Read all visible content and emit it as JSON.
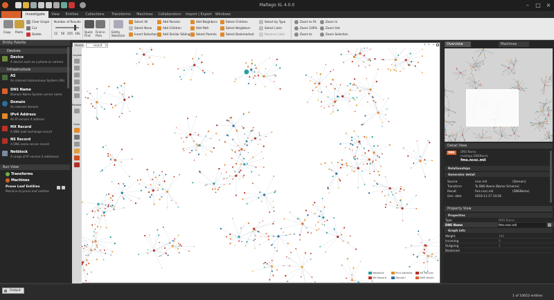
{
  "window": {
    "title": "Maltego XL 4.0.0",
    "quick_access": [
      "new-icon",
      "open-icon",
      "save-icon",
      "undo-icon",
      "redo-icon",
      "print-icon",
      "settings-icon",
      "transform-icon"
    ]
  },
  "menu_tabs": [
    "Investigate",
    "View",
    "Entities",
    "Collections",
    "Transforms",
    "Machines",
    "Collaboration",
    "Import | Export",
    "Windows"
  ],
  "active_tab": "Investigate",
  "ribbon": {
    "copy": "Copy",
    "paste": "Paste",
    "clear_graph": "Clear Graph",
    "cut": "Cut",
    "delete": "Delete",
    "results_label": "Number of Results",
    "results_ticks": [
      "12",
      "50",
      "255",
      "10k"
    ],
    "quick_find": "Quick Find",
    "find_in_files": "Find in Files",
    "entity_selection": "Entity Selection",
    "select_all": "Select All",
    "select_none": "Select None",
    "invert_selection": "Invert Selection",
    "add_parents": "Add Parents",
    "add_children": "Add Children",
    "add_similar_siblings": "Add Similar Siblings",
    "add_neighbors": "Add Neighbors",
    "add_path": "Add Path",
    "select_parents": "Select Parents",
    "select_children": "Select Children",
    "select_neighbors": "Select Neighbors",
    "select_bookmarked": "Select Bookmarked",
    "select_by_type": "Select by Type",
    "select_links": "Select Links",
    "reverse_links": "Reverse Links",
    "zoom_to_fit": "Zoom to Fit",
    "zoom_100": "Zoom 100%",
    "zoom_to": "Zoom to",
    "zoom_in": "Zoom In",
    "zoom_out": "Zoom Out",
    "zoom_selection": "Zoom Selection"
  },
  "palette": {
    "title": "Entity Palette",
    "cat1": "Devices",
    "cat2": "Infrastructure",
    "entities": [
      {
        "name": "Device",
        "desc": "A device such as a phone or camera",
        "color": "#6c8a3a"
      },
      {
        "name": "AS",
        "desc": "An internet Autonomous System (AS)",
        "color": "#4a6a3a"
      },
      {
        "name": "DNS Name",
        "desc": "Domain Name System server name",
        "color": "#d9602a"
      },
      {
        "name": "Domain",
        "desc": "An internet domain",
        "color": "#2c6e9e"
      },
      {
        "name": "IPv4 Address",
        "desc": "An IP version 4 address",
        "color": "#e08a2a"
      },
      {
        "name": "MX Record",
        "desc": "A DNS mail exchange record",
        "color": "#c03020"
      },
      {
        "name": "NS Record",
        "desc": "A DNS name server record",
        "color": "#b03028"
      },
      {
        "name": "Netblock",
        "desc": "A range of IP version 4 addresses",
        "color": "#7a8aa0"
      }
    ]
  },
  "run_view": {
    "title": "Run View",
    "transforms": "Transforms",
    "machines": "Machines",
    "selected_machine": "Prune Leaf Entities",
    "selected_desc": "Machine to prune leaf entities"
  },
  "graph": {
    "home_tab": "Home",
    "doc_tab": "ncsc4",
    "tools": [
      "Layout",
      "Palette",
      "View"
    ],
    "legend": [
      {
        "label": "Netblock",
        "color": "#2aa0a0"
      },
      {
        "label": "IPv4 Address",
        "color": "#e08a2a"
      },
      {
        "label": "NS Record",
        "color": "#b03028"
      },
      {
        "label": "MX Record",
        "color": "#c03020"
      },
      {
        "label": "Domain",
        "color": "#2c6e9e"
      },
      {
        "label": "DNS Name",
        "color": "#d9602a"
      }
    ]
  },
  "overview": {
    "tab1": "Overview",
    "tab2": "Machines"
  },
  "detail_view": {
    "title": "Detail View",
    "type_badge": "DNS",
    "entity_type": "DNS Name",
    "entity_type_id": "maltego.DNSName",
    "entity_value": "fms.ncsc.mil",
    "relationships": "Relationships",
    "generator": "Generator detail",
    "rows": [
      {
        "k": "Source",
        "v": "ncsc.mil",
        "v2": "(Domain)"
      },
      {
        "k": "Transform",
        "v": "To DNS Name [Name Scheme]",
        "v2": ""
      },
      {
        "k": "Result",
        "v": "fms.ncsc.mil",
        "v2": "(DNSName)"
      },
      {
        "k": "Gen. date",
        "v": "2016-11-17 10:28",
        "v2": ""
      }
    ]
  },
  "property_view": {
    "title": "Property View",
    "properties": "Properties",
    "type_k": "Type",
    "type_v": "DNS Name",
    "name_k": "DNS Name",
    "name_v": "fms.ncsc.mil",
    "graph_info": "Graph info",
    "rows": [
      {
        "k": "Weight",
        "v": "100"
      },
      {
        "k": "Incoming",
        "v": "0"
      },
      {
        "k": "Outgoing",
        "v": "1"
      },
      {
        "k": "Bookmark",
        "v": ""
      }
    ]
  },
  "status": {
    "output_tab": "Output",
    "count": "1 of 10652 entities"
  },
  "colors": {
    "accent": "#d9602a",
    "netblock": "#2aa0a0",
    "domain": "#2c6e9e",
    "ns": "#b03028"
  }
}
